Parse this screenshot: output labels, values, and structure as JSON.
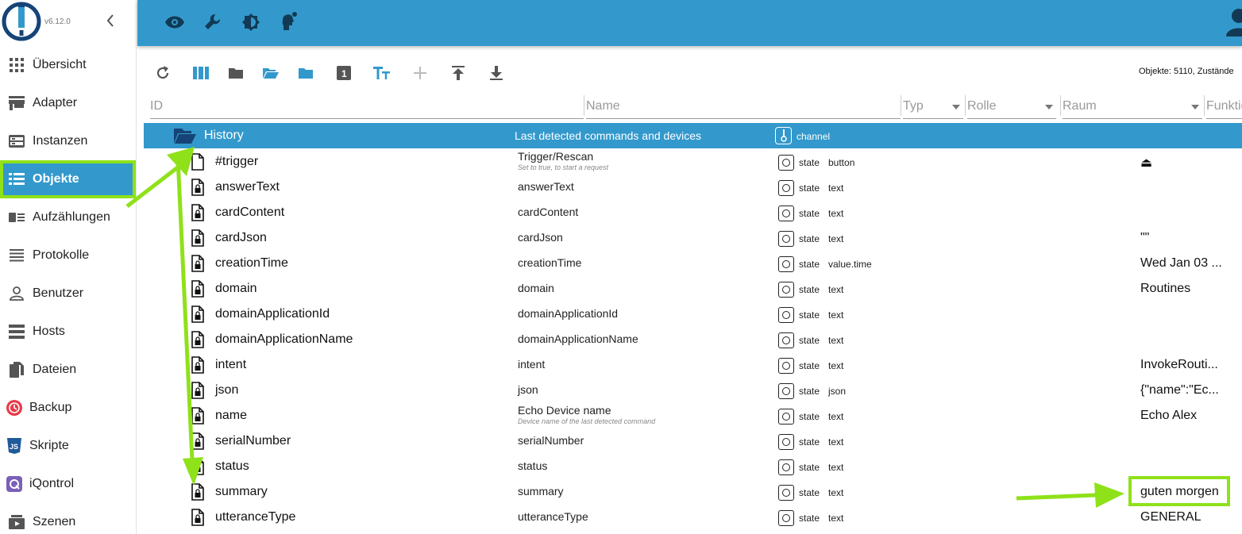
{
  "app": {
    "version": "v6.12.0"
  },
  "colors": {
    "accent": "#3399cc",
    "highlight": "#8fe11a",
    "topbar_icon": "#123a55"
  },
  "sidebar": {
    "items": [
      {
        "label": "Übersicht",
        "icon": "grid-icon"
      },
      {
        "label": "Adapter",
        "icon": "store-icon"
      },
      {
        "label": "Instanzen",
        "icon": "instances-icon"
      },
      {
        "label": "Objekte",
        "icon": "list-icon",
        "active": true
      },
      {
        "label": "Aufzählungen",
        "icon": "enum-icon"
      },
      {
        "label": "Protokolle",
        "icon": "log-icon"
      },
      {
        "label": "Benutzer",
        "icon": "user-icon"
      },
      {
        "label": "Hosts",
        "icon": "hosts-icon"
      },
      {
        "label": "Dateien",
        "icon": "files-icon"
      },
      {
        "label": "Backup",
        "icon": "backup-icon"
      },
      {
        "label": "Skripte",
        "icon": "js-icon"
      },
      {
        "label": "iQontrol",
        "icon": "iqontrol-icon"
      },
      {
        "label": "Szenen",
        "icon": "scenes-icon"
      }
    ]
  },
  "topbar": {
    "icons": [
      "eye-icon",
      "wrench-icon",
      "theme-icon",
      "expert-icon"
    ]
  },
  "toolbar": {
    "icons": [
      "refresh-icon",
      "columns-icon",
      "folder-icon",
      "folder-open-icon",
      "folder-closed-icon",
      "level-icon",
      "text-icon",
      "add-icon",
      "upload-icon",
      "download-icon"
    ],
    "object_count": "Objekte: 5110, Zustände"
  },
  "filters": {
    "id_placeholder": "ID",
    "name_placeholder": "Name",
    "type": "Typ",
    "role": "Rolle",
    "room": "Raum",
    "function": "Funktion"
  },
  "history": {
    "name": "History",
    "description": "Last detected commands and devices",
    "type": "channel"
  },
  "rows": [
    {
      "id": "#trigger",
      "name": "Trigger/Rescan",
      "subtitle": "Set to true, to start a request",
      "type": "state",
      "role": "button",
      "value": "⏏",
      "file": "plain"
    },
    {
      "id": "answerText",
      "name": "answerText",
      "type": "state",
      "role": "text",
      "value": ""
    },
    {
      "id": "cardContent",
      "name": "cardContent",
      "type": "state",
      "role": "text",
      "value": ""
    },
    {
      "id": "cardJson",
      "name": "cardJson",
      "type": "state",
      "role": "text",
      "value": "\"\""
    },
    {
      "id": "creationTime",
      "name": "creationTime",
      "type": "state",
      "role": "value.time",
      "value": "Wed Jan 03 ..."
    },
    {
      "id": "domain",
      "name": "domain",
      "type": "state",
      "role": "text",
      "value": "Routines"
    },
    {
      "id": "domainApplicationId",
      "name": "domainApplicationId",
      "type": "state",
      "role": "text",
      "value": ""
    },
    {
      "id": "domainApplicationName",
      "name": "domainApplicationName",
      "type": "state",
      "role": "text",
      "value": ""
    },
    {
      "id": "intent",
      "name": "intent",
      "type": "state",
      "role": "text",
      "value": "InvokeRouti..."
    },
    {
      "id": "json",
      "name": "json",
      "type": "state",
      "role": "json",
      "value": "{\"name\":\"Ec..."
    },
    {
      "id": "name",
      "name": "Echo Device name",
      "subtitle": "Device name of the last detected command",
      "type": "state",
      "role": "text",
      "value": "Echo Alex"
    },
    {
      "id": "serialNumber",
      "name": "serialNumber",
      "type": "state",
      "role": "text",
      "value": ""
    },
    {
      "id": "status",
      "name": "status",
      "type": "state",
      "role": "text",
      "value": ""
    },
    {
      "id": "summary",
      "name": "summary",
      "type": "state",
      "role": "text",
      "value": "guten morgen"
    },
    {
      "id": "utteranceType",
      "name": "utteranceType",
      "type": "state",
      "role": "text",
      "value": "GENERAL"
    }
  ]
}
